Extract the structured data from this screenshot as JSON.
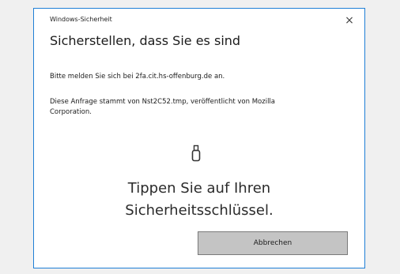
{
  "dialog": {
    "app_title": "Windows-Sicherheit",
    "heading": "Sicherstellen, dass Sie es sind",
    "sign_in_text": "Bitte melden Sie sich bei 2fa.cit.hs-offenburg.de an.",
    "request_text": "Diese Anfrage stammt von Nst2C52.tmp, veröffentlicht von Mozilla Corporation.",
    "prompt_line1": "Tippen Sie auf Ihren",
    "prompt_line2": "Sicherheitsschlüssel.",
    "cancel_label": "Abbrechen",
    "close_glyph": "×",
    "icon": "security-key-icon"
  },
  "colors": {
    "accent_border": "#1f7fd6",
    "button_bg": "#c4c4c4",
    "background": "#f0f0f0"
  }
}
